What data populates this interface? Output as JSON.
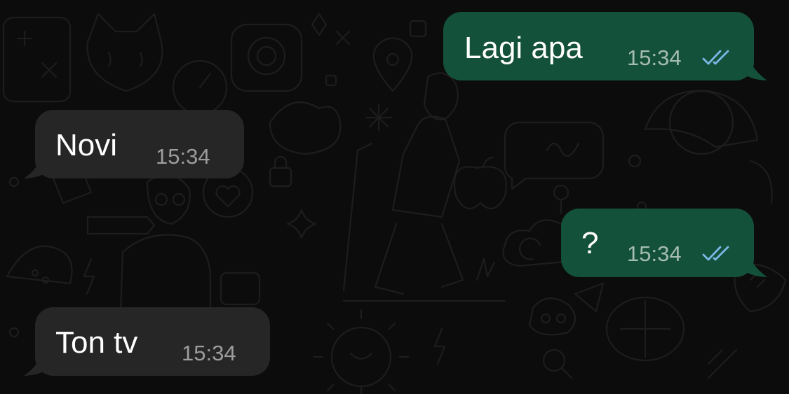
{
  "chat": {
    "messages": [
      {
        "direction": "outgoing",
        "text": "Lagi apa",
        "time": "15:34",
        "status_icon": "double-check-read-icon"
      },
      {
        "direction": "incoming",
        "text": "Novi",
        "time": "15:34"
      },
      {
        "direction": "outgoing",
        "text": "?",
        "time": "15:34",
        "status_icon": "double-check-read-icon"
      },
      {
        "direction": "incoming",
        "text": "Ton tv",
        "time": "15:34"
      }
    ]
  },
  "colors": {
    "background": "#0c0c0c",
    "outgoing_bubble": "#14513a",
    "incoming_bubble": "#262626",
    "read_ticks": "#79b7e6",
    "outgoing_time": "#a5bcb1",
    "incoming_time": "#9c9c9c",
    "message_text": "#ffffff"
  }
}
